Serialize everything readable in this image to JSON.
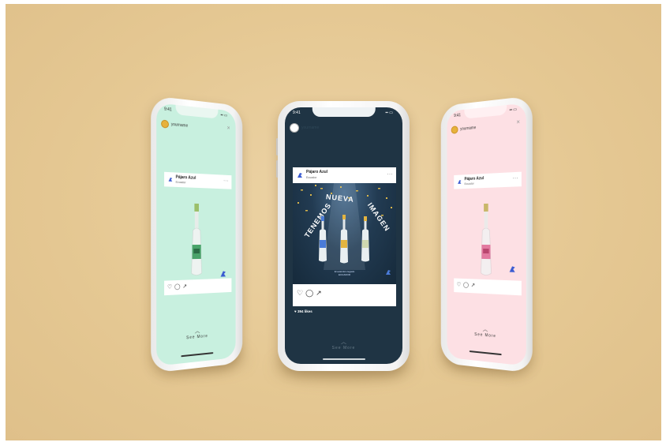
{
  "phones": [
    {
      "name": "left",
      "time": "9:41",
      "username": "yourname",
      "brand": "Pájaro Azul",
      "location": "Ecuador",
      "see_more": "See More",
      "screen_color": "#c8f0df"
    },
    {
      "name": "center",
      "time": "9:41",
      "username": "yourname",
      "brand": "Pájaro Azul",
      "location": "Ecuador",
      "headline": [
        "TENEMOS",
        "NUEVA",
        "IMAGEN"
      ],
      "sub_line_1": "El auténtico legado",
      "sub_line_2": "ECUADOR",
      "likes": "394 likes",
      "see_more": "See More",
      "screen_color": "#1f3444"
    },
    {
      "name": "right",
      "time": "9:41",
      "username": "yourname",
      "brand": "Pájaro Azul",
      "location": "Ecuador",
      "see_more": "See More",
      "screen_color": "#fde0e4"
    }
  ],
  "colors": {
    "background": "#e6c997",
    "accent_blue": "#3a5bd1",
    "gold": "#d8b54a"
  },
  "icons": [
    "heart-icon",
    "comment-icon",
    "share-icon",
    "close-icon",
    "more-dots-icon",
    "bird-logo-icon",
    "chevron-up-icon"
  ]
}
